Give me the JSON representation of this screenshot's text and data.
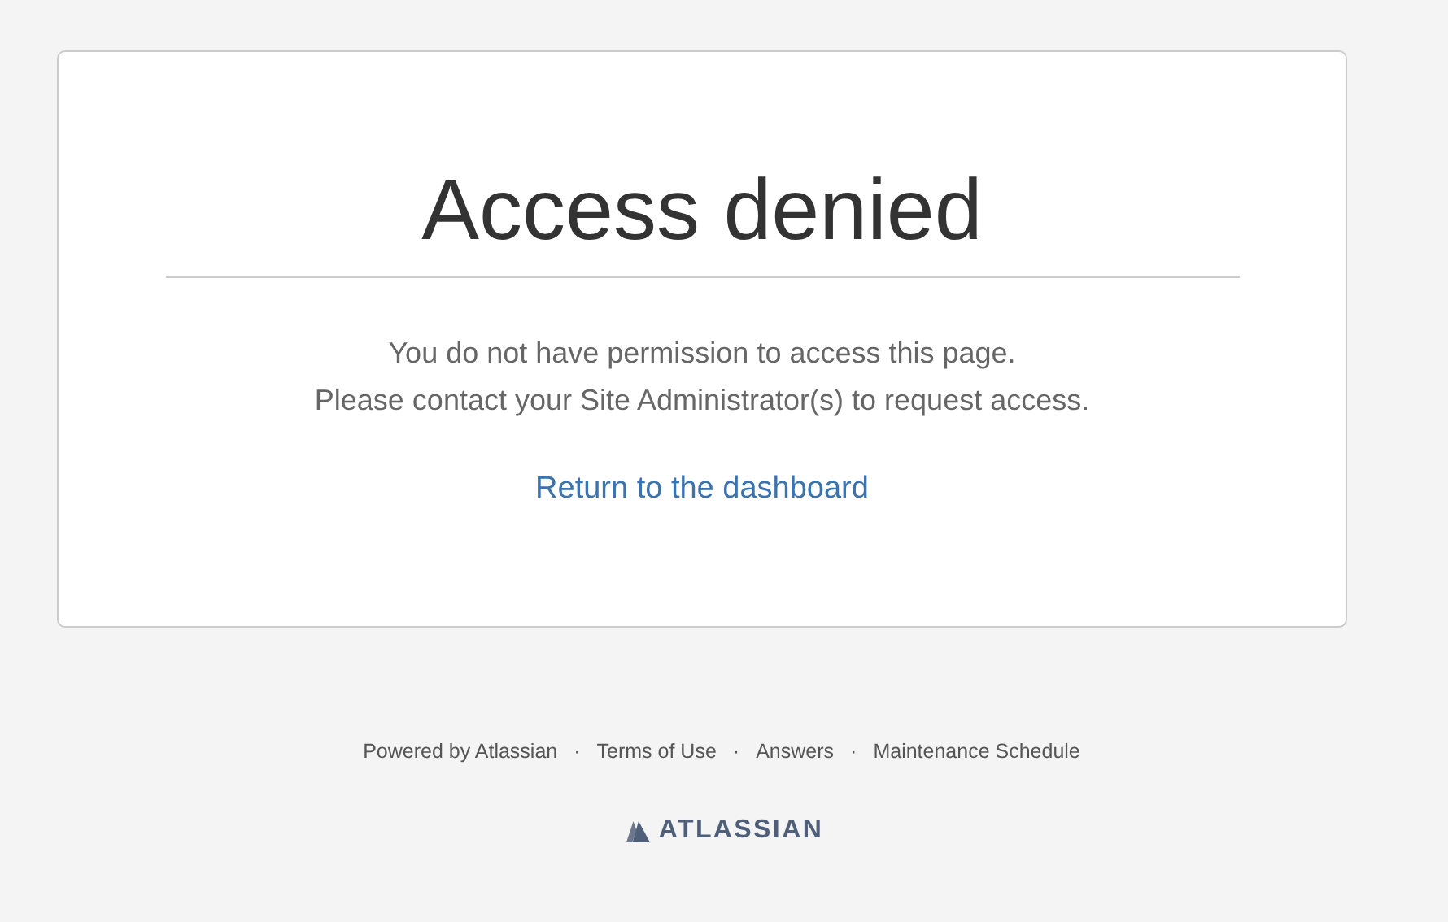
{
  "card": {
    "title": "Access denied",
    "message_lines": [
      "You do not have permission to access this page.",
      "Please contact your Site Administrator(s) to request access."
    ],
    "link": "Return to the dashboard"
  },
  "footer": {
    "links": [
      "Powered by Atlassian",
      "Terms of Use",
      "Answers",
      "Maintenance Schedule"
    ],
    "separator": "·",
    "logo_text": "ATLASSIAN"
  }
}
